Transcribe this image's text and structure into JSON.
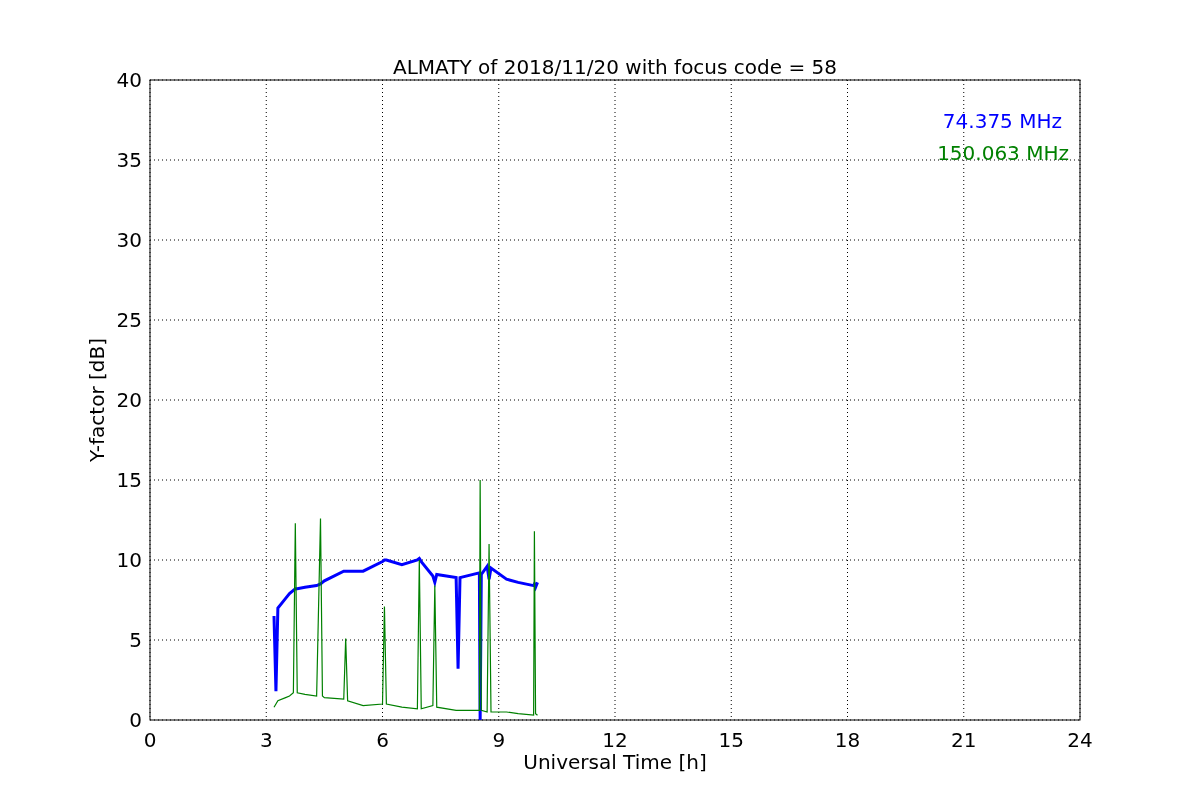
{
  "chart_data": {
    "type": "line",
    "title": "ALMATY of 2018/11/20 with focus code = 58",
    "xlabel": "Universal Time [h]",
    "ylabel": "Y-factor [dB]",
    "x": [
      3.2,
      3.25,
      3.3,
      3.5,
      3.6,
      3.7,
      3.75,
      3.8,
      4.0,
      4.3,
      4.4,
      4.45,
      4.5,
      5.0,
      5.05,
      5.1,
      5.5,
      6.0,
      6.05,
      6.1,
      6.5,
      6.9,
      6.95,
      7.0,
      7.3,
      7.35,
      7.4,
      7.9,
      7.95,
      8.0,
      8.5,
      8.52,
      8.55,
      8.7,
      8.75,
      8.8,
      9.2,
      9.5,
      9.9,
      9.92,
      9.95,
      10.0
    ],
    "series": [
      {
        "name": "74.375 MHz",
        "color": "#0000ff",
        "values": [
          6.5,
          1.8,
          7.0,
          7.6,
          7.9,
          8.1,
          8.2,
          8.2,
          8.3,
          8.4,
          8.5,
          8.6,
          8.7,
          9.3,
          9.3,
          9.3,
          9.3,
          9.9,
          10.0,
          10.0,
          9.7,
          10.0,
          10.1,
          9.9,
          9.0,
          8.6,
          9.1,
          8.9,
          3.2,
          8.9,
          9.2,
          0,
          9.1,
          9.6,
          8.8,
          9.5,
          8.8,
          8.6,
          8.4,
          8.5,
          8.3,
          8.6
        ]
      },
      {
        "name": "150.063 MHz",
        "color": "#008000",
        "values": [
          0.8,
          1.0,
          1.2,
          1.4,
          1.5,
          1.7,
          12.3,
          1.7,
          1.6,
          1.5,
          12.6,
          1.5,
          1.4,
          1.3,
          5.1,
          1.2,
          0.9,
          1.0,
          7.1,
          1.0,
          0.8,
          0.7,
          10.0,
          0.7,
          0.9,
          8.4,
          0.8,
          0.6,
          0.6,
          0.6,
          0.6,
          15.0,
          0.6,
          0.5,
          11.0,
          0.5,
          0.5,
          0.4,
          0.3,
          11.8,
          0.4,
          0.3
        ]
      }
    ],
    "xlim": [
      0,
      24
    ],
    "ylim": [
      0,
      40
    ],
    "xticks": [
      0,
      3,
      6,
      9,
      12,
      15,
      18,
      21,
      24
    ],
    "yticks": [
      0,
      5,
      10,
      15,
      20,
      25,
      30,
      35,
      40
    ],
    "grid": true
  }
}
